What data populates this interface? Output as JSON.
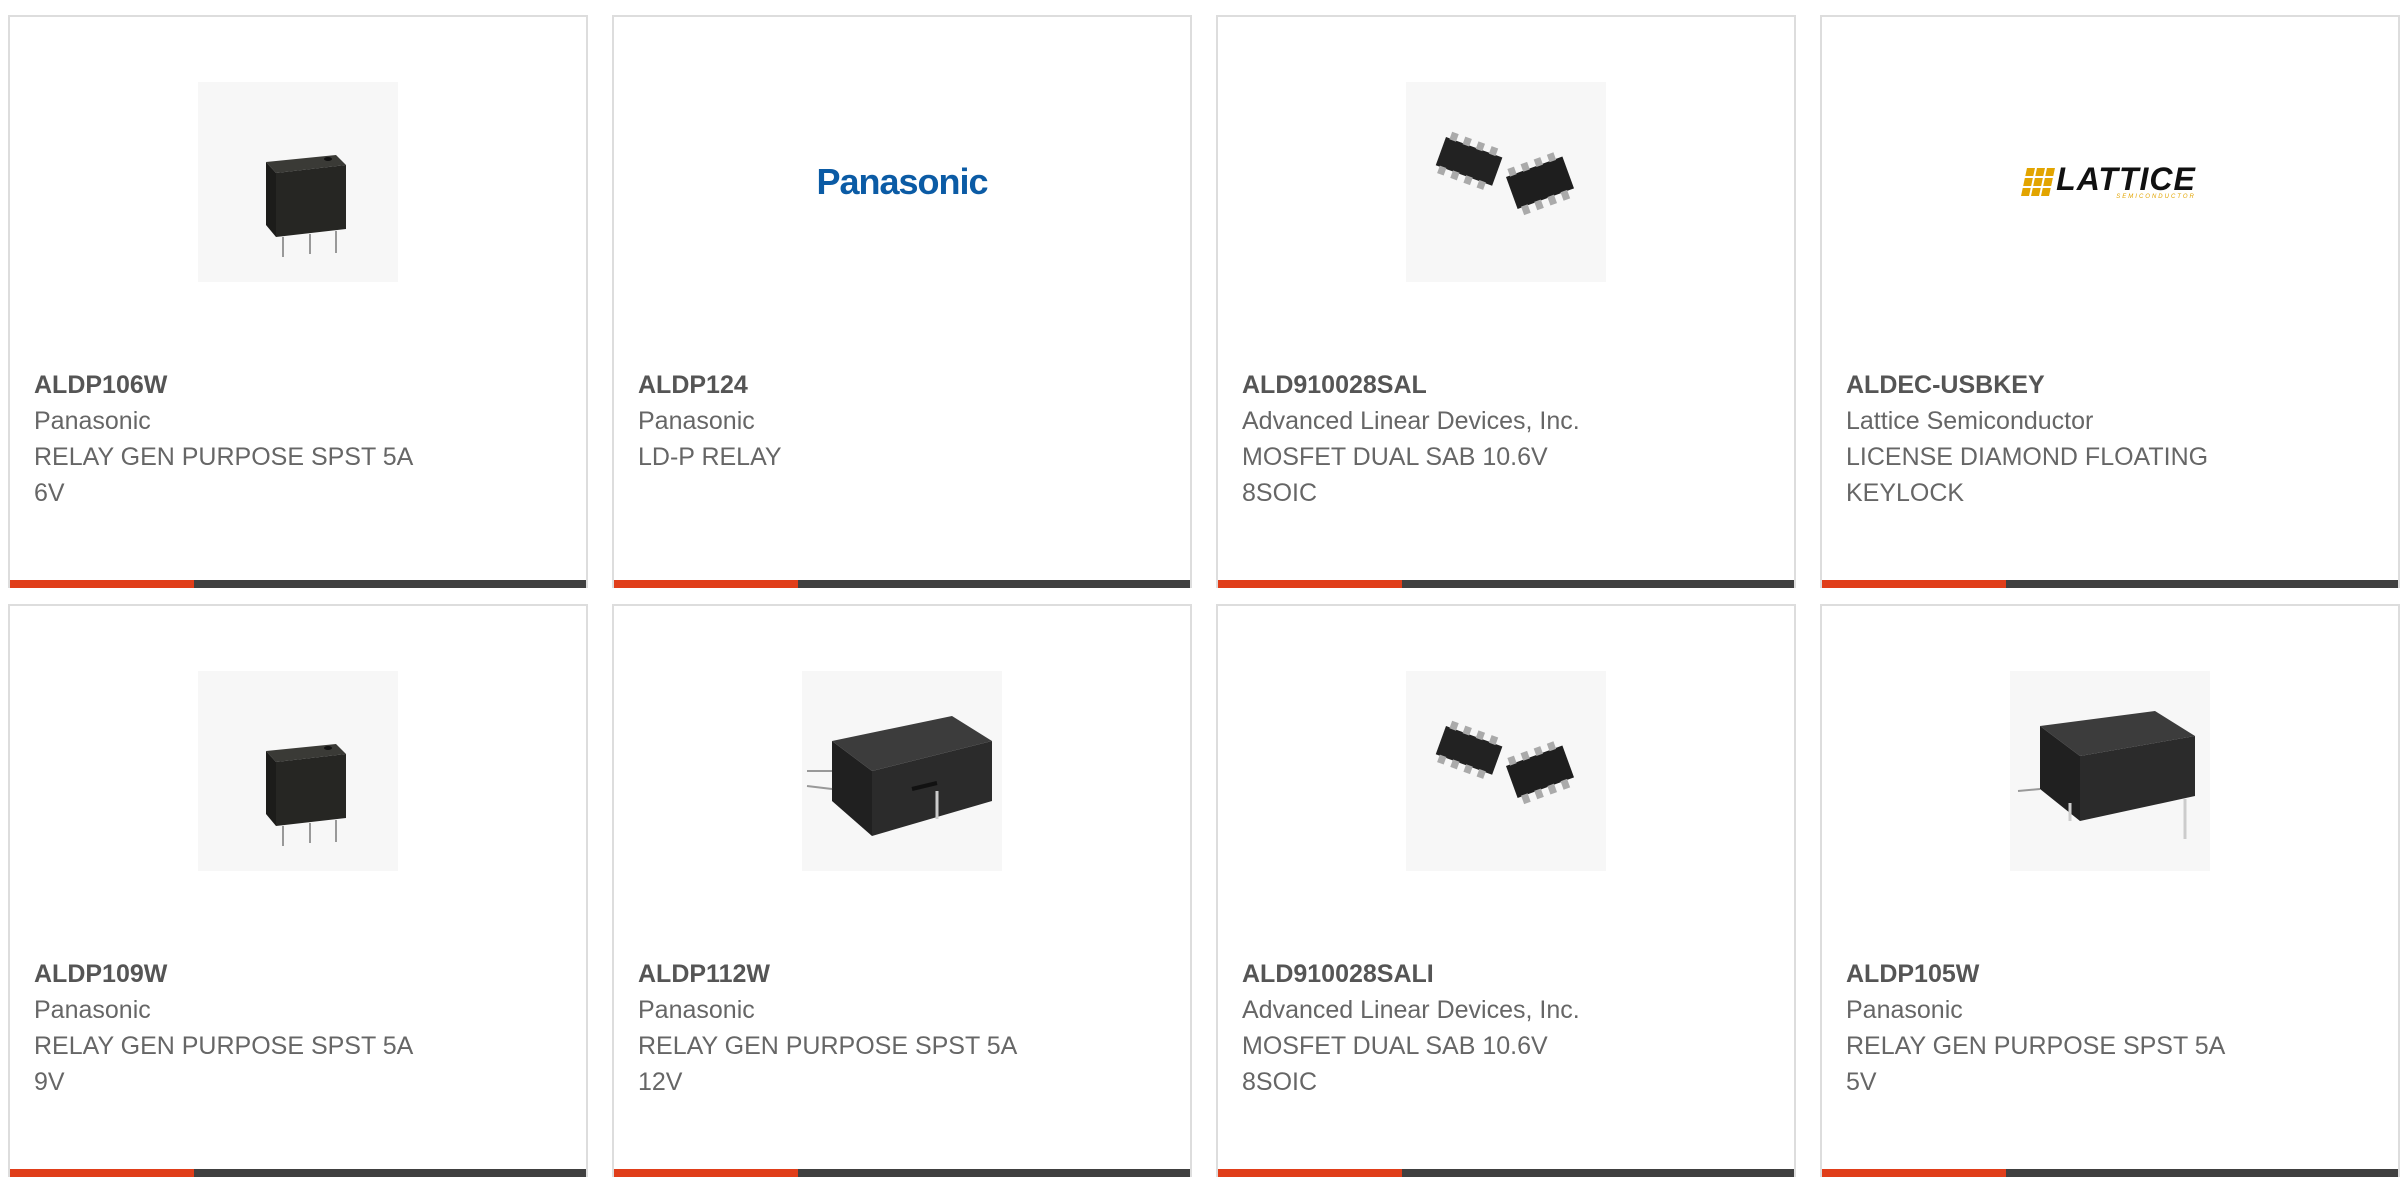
{
  "colors": {
    "accent": "#e03e1a",
    "bar": "#404040",
    "border": "#dddddd",
    "panasonic_blue": "#0b5ba5",
    "lattice_gold": "#e2a400"
  },
  "products": [
    {
      "part_number": "ALDP106W",
      "manufacturer": "Panasonic",
      "description_line1": "RELAY GEN PURPOSE SPST 5A",
      "description_line2": "6V",
      "image": "relay-small-icon"
    },
    {
      "part_number": "ALDP124",
      "manufacturer": "Panasonic",
      "description_line1": "LD-P RELAY",
      "description_line2": "",
      "image": "panasonic-logo",
      "logo_text": "Panasonic"
    },
    {
      "part_number": "ALD910028SAL",
      "manufacturer": "Advanced Linear Devices, Inc.",
      "description_line1": "MOSFET DUAL SAB 10.6V",
      "description_line2": "8SOIC",
      "image": "soic8-chip-icon"
    },
    {
      "part_number": "ALDEC-USBKEY",
      "manufacturer": "Lattice Semiconductor",
      "description_line1": "LICENSE DIAMOND FLOATING",
      "description_line2": "KEYLOCK",
      "image": "lattice-logo",
      "logo_text": "LATTICE",
      "logo_subtext": "SEMICONDUCTOR"
    },
    {
      "part_number": "ALDP109W",
      "manufacturer": "Panasonic",
      "description_line1": "RELAY GEN PURPOSE SPST 5A",
      "description_line2": "9V",
      "image": "relay-small-icon"
    },
    {
      "part_number": "ALDP112W",
      "manufacturer": "Panasonic",
      "description_line1": "RELAY GEN PURPOSE SPST 5A",
      "description_line2": "12V",
      "image": "relay-flat-icon"
    },
    {
      "part_number": "ALD910028SALI",
      "manufacturer": "Advanced Linear Devices, Inc.",
      "description_line1": "MOSFET DUAL SAB 10.6V",
      "description_line2": "8SOIC",
      "image": "soic8-chip-icon"
    },
    {
      "part_number": "ALDP105W",
      "manufacturer": "Panasonic",
      "description_line1": "RELAY GEN PURPOSE SPST 5A",
      "description_line2": "5V",
      "image": "relay-flat-icon"
    }
  ]
}
